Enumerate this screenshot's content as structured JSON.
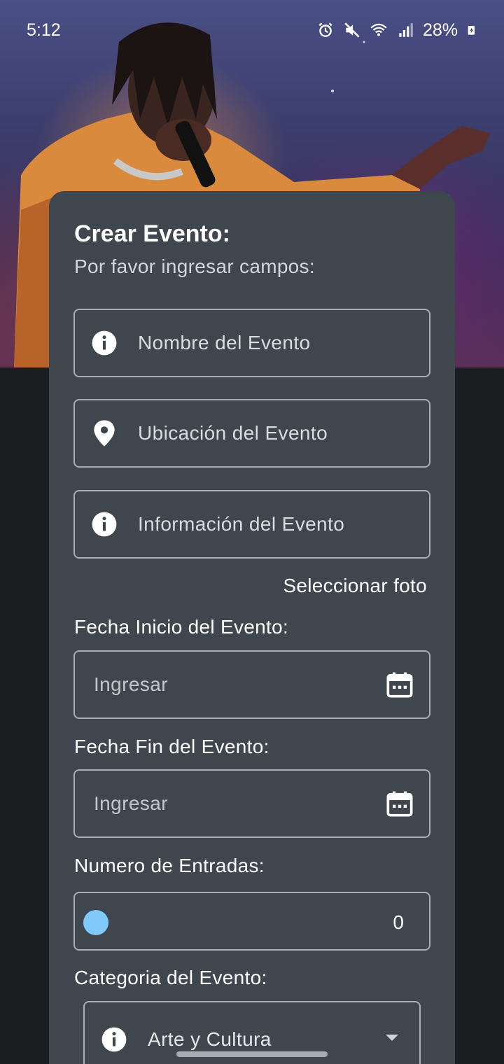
{
  "status_bar": {
    "time": "5:12",
    "battery": "28%",
    "icons": [
      "alarm-icon",
      "mute-icon",
      "wifi-icon",
      "signal-icon",
      "battery-charging-icon"
    ]
  },
  "hero": {
    "image": "performer-photo"
  },
  "form": {
    "title": "Crear Evento:",
    "subtitle": "Por favor ingresar campos:",
    "fields": {
      "name": {
        "placeholder": "Nombre del Evento",
        "icon": "info-icon"
      },
      "location": {
        "placeholder": "Ubicación del Evento",
        "icon": "location-pin-icon"
      },
      "info": {
        "placeholder": "Información del Evento",
        "icon": "info-icon"
      }
    },
    "select_photo": "Seleccionar foto",
    "start_date": {
      "label": "Fecha Inicio del Evento:",
      "placeholder": "Ingresar",
      "icon": "calendar-icon"
    },
    "end_date": {
      "label": "Fecha Fin del Evento:",
      "placeholder": "Ingresar",
      "icon": "calendar-icon"
    },
    "tickets": {
      "label": "Numero de Entradas:",
      "value": "0",
      "knob_color": "#80caf9"
    },
    "category": {
      "label": "Categoria del Evento:",
      "selected": "Arte y Cultura",
      "icon": "info-icon"
    }
  },
  "colors": {
    "card_bg": "#40464d",
    "page_bg": "#1b1e21",
    "accent": "#80caf9"
  }
}
